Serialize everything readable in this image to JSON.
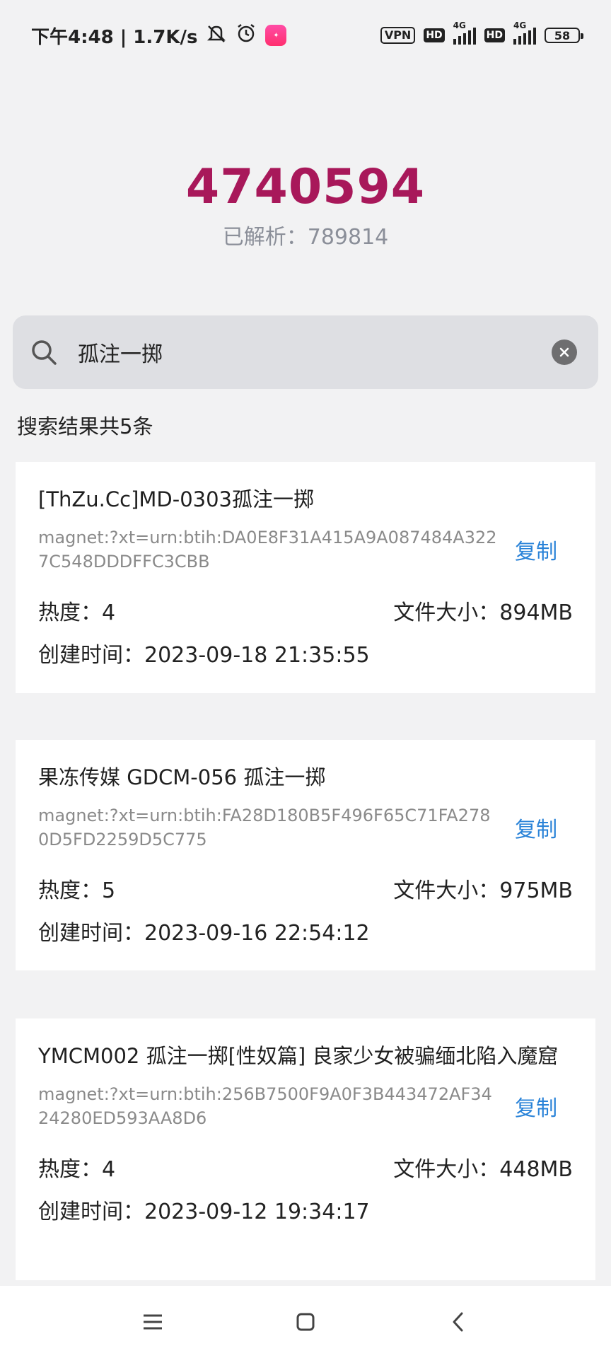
{
  "status_bar": {
    "time_speed": "下午4:48 | 1.7K/s",
    "vpn": "VPN",
    "hd1": "HD",
    "net1": "4G",
    "hd2": "HD",
    "net2": "4G",
    "battery": "58"
  },
  "header": {
    "total_count": "4740594",
    "parsed_label": "已解析：",
    "parsed_value": "789814"
  },
  "search": {
    "value": "孤注一掷",
    "placeholder": ""
  },
  "results_summary": "搜索结果共5条",
  "results": [
    {
      "title": "[ThZu.Cc]MD-0303孤注一掷",
      "magnet": "magnet:?xt=urn:btih:DA0E8F31A415A9A087484A3227C548DDDFFC3CBB",
      "copy_label": "复制",
      "heat": "热度：4",
      "size": "文件大小：894MB",
      "created": "创建时间：2023-09-18 21:35:55"
    },
    {
      "title": "果冻传媒 GDCM-056 孤注一掷",
      "magnet": "magnet:?xt=urn:btih:FA28D180B5F496F65C71FA2780D5FD2259D5C775",
      "copy_label": "复制",
      "heat": "热度：5",
      "size": "文件大小：975MB",
      "created": "创建时间：2023-09-16 22:54:12"
    },
    {
      "title": "YMCM002 孤注一掷[性奴篇] 良家少女被骗缅北陷入魔窟",
      "magnet": "magnet:?xt=urn:btih:256B7500F9A0F3B443472AF3424280ED593AA8D6",
      "copy_label": "复制",
      "heat": "热度：4",
      "size": "文件大小：448MB",
      "created": "创建时间：2023-09-12 19:34:17"
    }
  ],
  "colors": {
    "accent": "#a8185a",
    "link": "#2a83d8"
  }
}
